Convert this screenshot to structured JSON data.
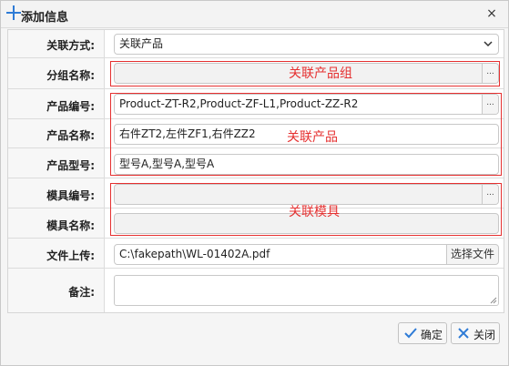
{
  "dialog": {
    "title": "添加信息",
    "close_icon": "×"
  },
  "form": {
    "link_type": {
      "label": "关联方式:",
      "value": "关联产品"
    },
    "group_name": {
      "label": "分组名称:",
      "value": "",
      "dots": "..."
    },
    "product_code": {
      "label": "产品编号:",
      "value": "Product-ZT-R2,Product-ZF-L1,Product-ZZ-R2",
      "dots": "..."
    },
    "product_name": {
      "label": "产品名称:",
      "value": "右件ZT2,左件ZF1,右件ZZ2"
    },
    "product_model": {
      "label": "产品型号:",
      "value": "型号A,型号A,型号A"
    },
    "mold_code": {
      "label": "模具编号:",
      "value": "",
      "dots": "..."
    },
    "mold_name": {
      "label": "模具名称:",
      "value": ""
    },
    "file_upload": {
      "label": "文件上传:",
      "value": "C:\\fakepath\\WL-01402A.pdf",
      "button": "选择文件"
    },
    "remark": {
      "label": "备注:",
      "value": ""
    }
  },
  "annotations": {
    "group": "关联产品组",
    "product": "关联产品",
    "mold": "关联模具"
  },
  "footer": {
    "confirm": "确定",
    "close": "关闭"
  },
  "colors": {
    "annotation": "#e53030",
    "accent": "#2e7bd6"
  }
}
